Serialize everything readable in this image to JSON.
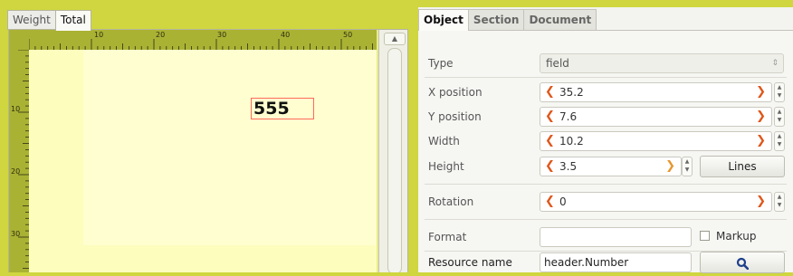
{
  "designer": {
    "tabs": [
      {
        "label": "Weight",
        "active": false
      },
      {
        "label": "Total",
        "active": true
      }
    ],
    "ruler_top_labels": [
      "10",
      "20",
      "30",
      "40",
      "50"
    ],
    "ruler_left_labels": [
      "10",
      "20",
      "30"
    ],
    "field_text": "555",
    "scroll_up_icon": "▲"
  },
  "properties": {
    "tabs": [
      {
        "label": "Object",
        "active": true
      },
      {
        "label": "Section",
        "active": false
      },
      {
        "label": "Document",
        "active": false
      }
    ],
    "type": {
      "label": "Type",
      "value": "field"
    },
    "x_position": {
      "label": "X position",
      "value": "35.2"
    },
    "y_position": {
      "label": "Y position",
      "value": "7.6"
    },
    "width": {
      "label": "Width",
      "value": "10.2"
    },
    "height": {
      "label": "Height",
      "value": "3.5",
      "lines_button": "Lines"
    },
    "rotation": {
      "label": "Rotation",
      "value": "0"
    },
    "format": {
      "label": "Format",
      "value": "",
      "markup_label": "Markup",
      "markup_checked": false
    },
    "resource_name": {
      "label": "Resource name",
      "value": "header.Number",
      "search_icon": "search-icon"
    }
  },
  "colors": {
    "background": "#cfd63f",
    "ruler": "#aab234",
    "paper": "#fdfdbe",
    "selection_border": "#ff6a5a",
    "spin_arrow": "#e0561a"
  },
  "icons": {
    "decrement": "chevron-left-icon",
    "increment": "chevron-right-icon",
    "stepper": "up-down-arrows-icon",
    "combo": "dropdown-arrows-icon"
  }
}
